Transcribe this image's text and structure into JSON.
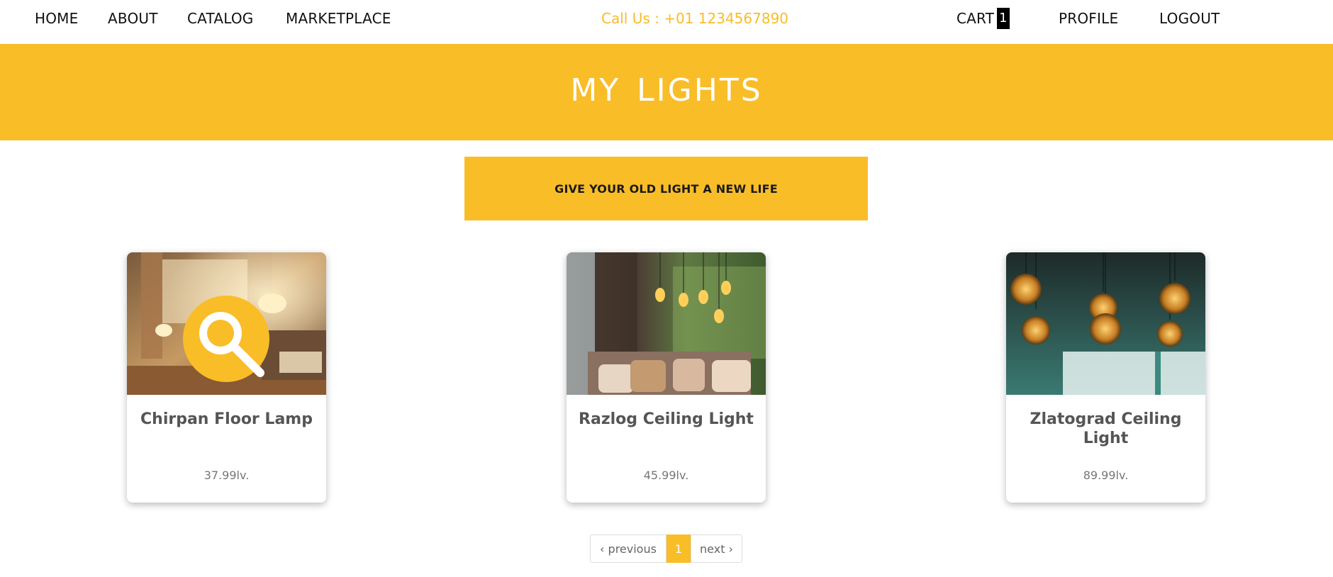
{
  "nav": {
    "home": "HOME",
    "about": "ABOUT",
    "catalog": "CATALOG",
    "marketplace": "MARKETPLACE",
    "call": "Call Us : +01 1234567890",
    "cart": "CART",
    "cart_count": "1",
    "profile": "PROFILE",
    "logout": "LOGOUT"
  },
  "hero": {
    "title": "MY LIGHTS"
  },
  "cta": {
    "label": "GIVE YOUR OLD LIGHT A NEW LIFE"
  },
  "products": [
    {
      "title": "Chirpan Floor Lamp",
      "price": "37.99lv."
    },
    {
      "title": "Razlog Ceiling Light",
      "price": "45.99lv."
    },
    {
      "title": "Zlatograd Ceiling Light",
      "price": "89.99lv."
    }
  ],
  "pagination": {
    "previous": "‹ previous",
    "current": "1",
    "next": "next ›"
  },
  "colors": {
    "accent": "#f9bd28",
    "text": "#111111",
    "muted": "#777777"
  }
}
